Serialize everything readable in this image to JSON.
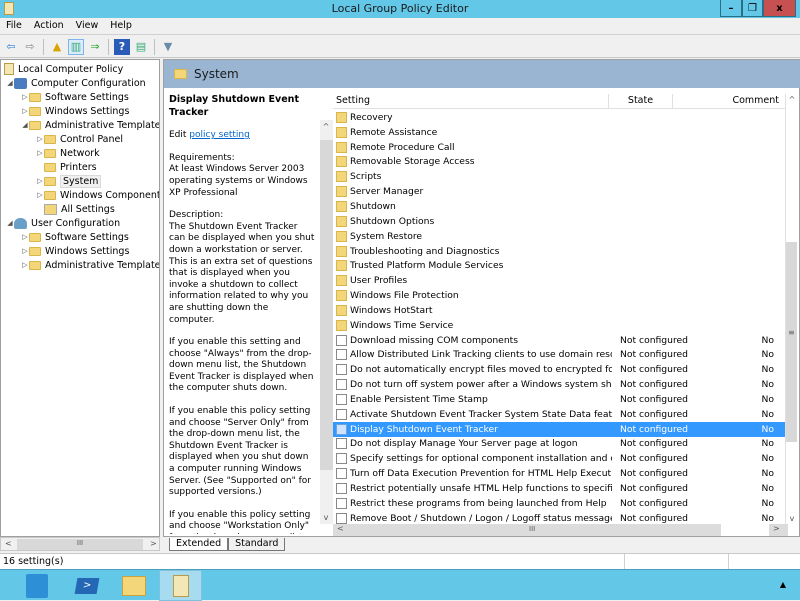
{
  "window": {
    "title": "Local Group Policy Editor",
    "controls": {
      "minimize": "–",
      "maximize": "❐",
      "close": "x"
    }
  },
  "menu": [
    "File",
    "Action",
    "View",
    "Help"
  ],
  "toolbar": [
    {
      "name": "back-icon",
      "glyph": "⇦"
    },
    {
      "name": "forward-icon",
      "glyph": "⇨"
    },
    {
      "name": "up-folder-icon",
      "glyph": "▲"
    },
    {
      "name": "show-hide-tree-icon",
      "glyph": "▥"
    },
    {
      "name": "export-list-icon",
      "glyph": "⇒"
    },
    {
      "name": "help-icon",
      "glyph": "?"
    },
    {
      "name": "show-action-pane-icon",
      "glyph": "▤"
    },
    {
      "name": "filter-icon",
      "glyph": "▼"
    }
  ],
  "tree": {
    "items": [
      {
        "label": "Local Computer Policy",
        "icon": "policy-doc-icon",
        "arrow": "",
        "level": 0
      },
      {
        "label": "Computer Configuration",
        "icon": "computer-icon",
        "arrow": "◢",
        "level": 1
      },
      {
        "label": "Software Settings",
        "icon": "folder-icon",
        "arrow": "▷",
        "level": 2
      },
      {
        "label": "Windows Settings",
        "icon": "folder-icon",
        "arrow": "▷",
        "level": 2
      },
      {
        "label": "Administrative Templates",
        "icon": "folder-icon",
        "arrow": "◢",
        "level": 2
      },
      {
        "label": "Control Panel",
        "icon": "folder-icon",
        "arrow": "▷",
        "level": 3
      },
      {
        "label": "Network",
        "icon": "folder-icon",
        "arrow": "▷",
        "level": 3
      },
      {
        "label": "Printers",
        "icon": "folder-icon",
        "arrow": "",
        "level": 3
      },
      {
        "label": "System",
        "icon": "folder-icon",
        "arrow": "▷",
        "level": 3,
        "selected": true
      },
      {
        "label": "Windows Components",
        "icon": "folder-icon",
        "arrow": "▷",
        "level": 3
      },
      {
        "label": "All Settings",
        "icon": "all-settings-icon",
        "arrow": "",
        "level": 3
      },
      {
        "label": "User Configuration",
        "icon": "user-icon",
        "arrow": "◢",
        "level": 1
      },
      {
        "label": "Software Settings",
        "icon": "folder-icon",
        "arrow": "▷",
        "level": 2
      },
      {
        "label": "Windows Settings",
        "icon": "folder-icon",
        "arrow": "▷",
        "level": 2
      },
      {
        "label": "Administrative Templates",
        "icon": "folder-icon",
        "arrow": "▷",
        "level": 2
      }
    ]
  },
  "main": {
    "header": "System",
    "description": {
      "title": "Display Shutdown Event Tracker",
      "edit_prefix": "Edit ",
      "edit_link": "policy setting",
      "requirements_label": "Requirements:",
      "requirements": "At least Windows Server 2003 operating systems or Windows XP Professional",
      "description_label": "Description:",
      "paragraphs": [
        "The Shutdown Event Tracker can be displayed when you shut down a workstation or server.  This is an extra set of questions that is displayed when you invoke a shutdown to collect information related to why you are shutting down the computer.",
        "If you enable this setting and choose \"Always\" from the drop-down menu list, the Shutdown Event Tracker is displayed when the computer shuts down.",
        "If you enable this policy setting and choose \"Server Only\" from the drop-down menu list, the Shutdown Event Tracker is displayed when you shut down a computer running Windows Server. (See \"Supported on\" for supported versions.)",
        "If you enable this policy setting and choose \"Workstation Only\" from the drop-down menu list,"
      ]
    },
    "columns": {
      "setting": "Setting",
      "state": "State",
      "comment": "Comment"
    },
    "rows": [
      {
        "type": "folder",
        "name": "Recovery",
        "state": "",
        "comment": ""
      },
      {
        "type": "folder",
        "name": "Remote Assistance",
        "state": "",
        "comment": ""
      },
      {
        "type": "folder",
        "name": "Remote Procedure Call",
        "state": "",
        "comment": ""
      },
      {
        "type": "folder",
        "name": "Removable Storage Access",
        "state": "",
        "comment": ""
      },
      {
        "type": "folder",
        "name": "Scripts",
        "state": "",
        "comment": ""
      },
      {
        "type": "folder",
        "name": "Server Manager",
        "state": "",
        "comment": ""
      },
      {
        "type": "folder",
        "name": "Shutdown",
        "state": "",
        "comment": ""
      },
      {
        "type": "folder",
        "name": "Shutdown Options",
        "state": "",
        "comment": ""
      },
      {
        "type": "folder",
        "name": "System Restore",
        "state": "",
        "comment": ""
      },
      {
        "type": "folder",
        "name": "Troubleshooting and Diagnostics",
        "state": "",
        "comment": ""
      },
      {
        "type": "folder",
        "name": "Trusted Platform Module Services",
        "state": "",
        "comment": ""
      },
      {
        "type": "folder",
        "name": "User Profiles",
        "state": "",
        "comment": ""
      },
      {
        "type": "folder",
        "name": "Windows File Protection",
        "state": "",
        "comment": ""
      },
      {
        "type": "folder",
        "name": "Windows HotStart",
        "state": "",
        "comment": ""
      },
      {
        "type": "folder",
        "name": "Windows Time Service",
        "state": "",
        "comment": ""
      },
      {
        "type": "policy",
        "name": "Download missing COM components",
        "state": "Not configured",
        "comment": "No"
      },
      {
        "type": "policy",
        "name": "Allow Distributed Link Tracking clients to use domain resour...",
        "state": "Not configured",
        "comment": "No"
      },
      {
        "type": "policy",
        "name": "Do not automatically encrypt files moved to encrypted fold...",
        "state": "Not configured",
        "comment": "No"
      },
      {
        "type": "policy",
        "name": "Do not turn off system power after a Windows system shutd...",
        "state": "Not configured",
        "comment": "No"
      },
      {
        "type": "policy",
        "name": "Enable Persistent Time Stamp",
        "state": "Not configured",
        "comment": "No"
      },
      {
        "type": "policy",
        "name": "Activate Shutdown Event Tracker System State Data feature",
        "state": "Not configured",
        "comment": "No"
      },
      {
        "type": "policy",
        "name": "Display Shutdown Event Tracker",
        "state": "Not configured",
        "comment": "No",
        "selected": true
      },
      {
        "type": "policy",
        "name": "Do not display Manage Your Server page at logon",
        "state": "Not configured",
        "comment": "No"
      },
      {
        "type": "policy",
        "name": "Specify settings for optional component installation and co...",
        "state": "Not configured",
        "comment": "No"
      },
      {
        "type": "policy",
        "name": "Turn off Data Execution Prevention for HTML Help Executible",
        "state": "Not configured",
        "comment": "No"
      },
      {
        "type": "policy",
        "name": "Restrict potentially unsafe HTML Help functions to specified...",
        "state": "Not configured",
        "comment": "No"
      },
      {
        "type": "policy",
        "name": "Restrict these programs from being launched from Help",
        "state": "Not configured",
        "comment": "No"
      },
      {
        "type": "policy",
        "name": "Remove Boot / Shutdown / Logon / Logoff status messages",
        "state": "Not configured",
        "comment": "No"
      }
    ],
    "tabs": [
      "Extended",
      "Standard"
    ]
  },
  "status": "16 setting(s)",
  "taskbar": {
    "apps": [
      "server-manager-icon",
      "powershell-icon",
      "file-explorer-icon",
      "group-policy-editor-icon"
    ],
    "tray_arrow": "▲",
    "scroll_glyphs": {
      "up": "^",
      "down": "v",
      "left": "<",
      "right": ">",
      "grip": "III",
      "mid": "≡"
    }
  },
  "colors": {
    "titlebar": "#63c7e8",
    "selection": "#3399ff",
    "header": "#9ab5d2",
    "close": "#c75050"
  }
}
